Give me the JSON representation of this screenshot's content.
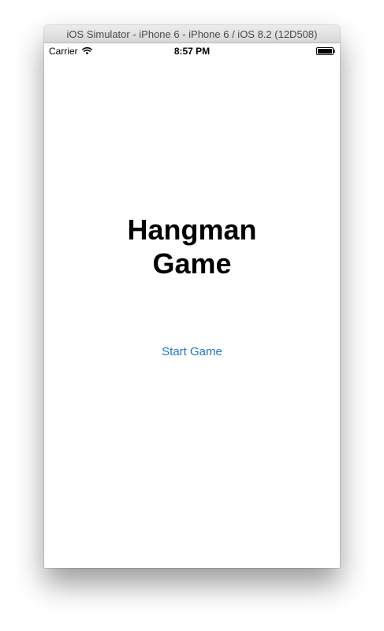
{
  "window": {
    "title": "iOS Simulator - iPhone 6 - iPhone 6 / iOS 8.2 (12D508)"
  },
  "status_bar": {
    "carrier": "Carrier",
    "time": "8:57 PM",
    "wifi_icon": "wifi-icon",
    "battery_icon": "battery-icon",
    "battery_level": 1.0
  },
  "main": {
    "title_line1": "Hangman",
    "title_line2": "Game",
    "start_button_label": "Start Game"
  },
  "colors": {
    "link": "#1f73d0",
    "title": "#000000"
  }
}
